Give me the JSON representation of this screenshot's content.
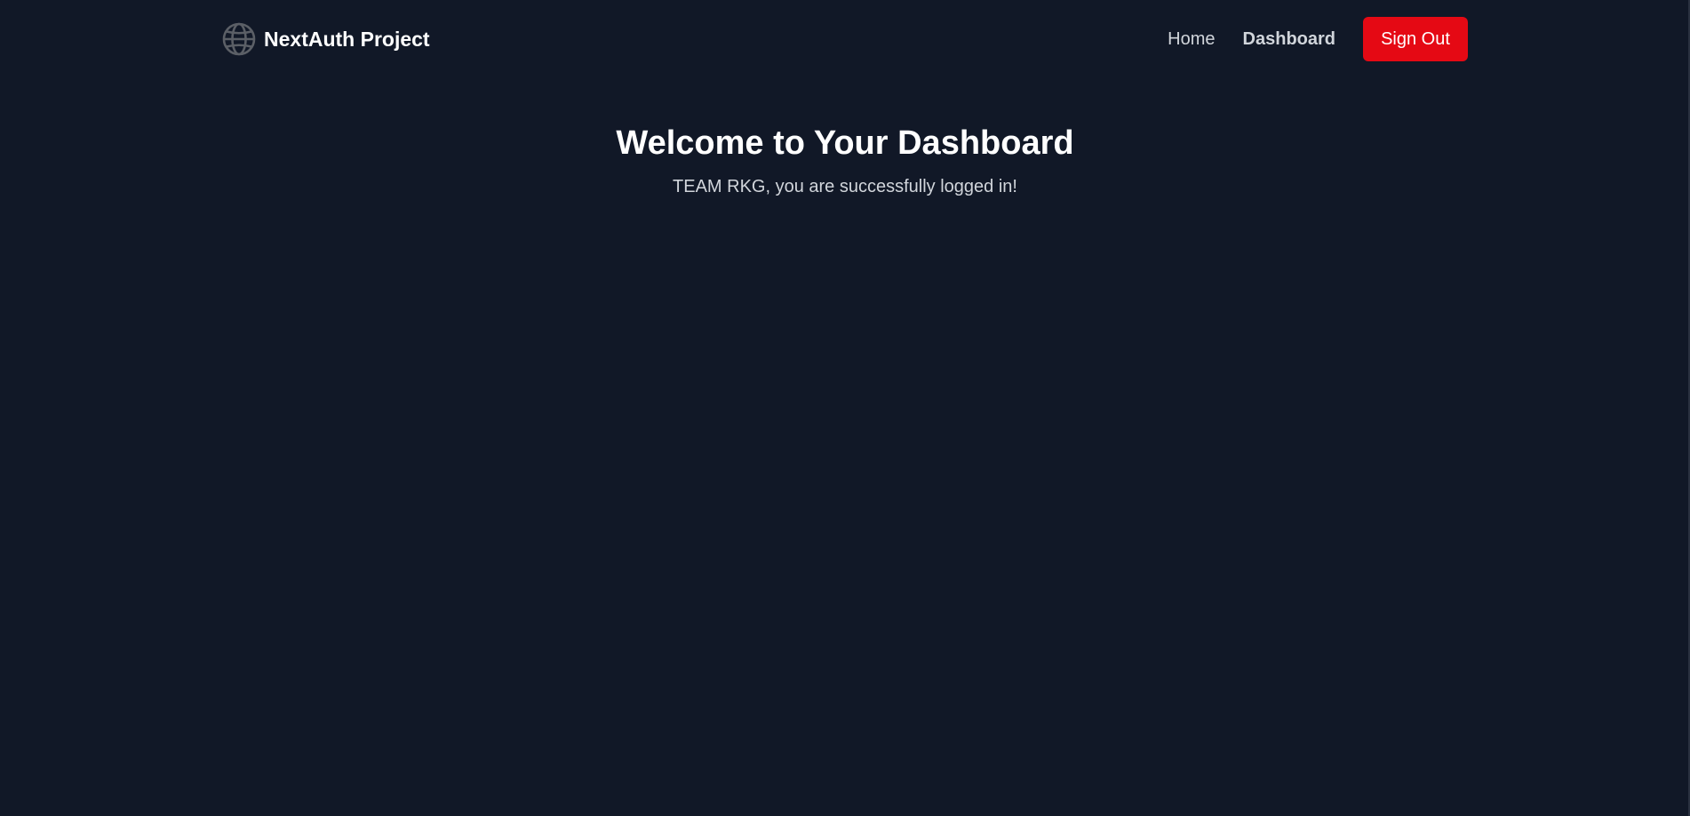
{
  "header": {
    "brand": {
      "name": "NextAuth Project",
      "icon": "globe-icon"
    },
    "nav": {
      "home_label": "Home",
      "dashboard_label": "Dashboard",
      "active": "Dashboard"
    },
    "signout_label": "Sign Out"
  },
  "main": {
    "title": "Welcome to Your Dashboard",
    "message": "TEAM RKG, you are successfully logged in!"
  },
  "colors": {
    "background": "#111827",
    "accent": "#e50914",
    "text_primary": "#ffffff",
    "text_secondary": "#d1d5db"
  }
}
